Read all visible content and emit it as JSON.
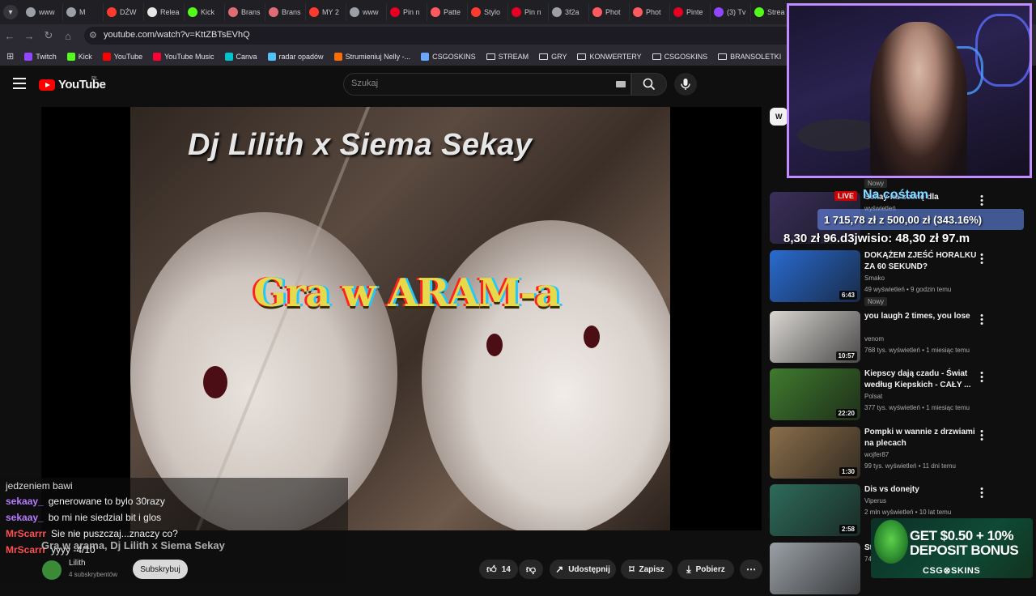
{
  "browser": {
    "tabs": [
      {
        "label": "www",
        "color": "#9aa0a6"
      },
      {
        "label": "M",
        "color": "#9aa0a6"
      },
      {
        "label": "DŹW",
        "color": "#ff3b30"
      },
      {
        "label": "Relea",
        "color": "#e6e6e6"
      },
      {
        "label": "Kick",
        "color": "#53fc18"
      },
      {
        "label": "Brans",
        "color": "#e06c75"
      },
      {
        "label": "Brans",
        "color": "#e06c75"
      },
      {
        "label": "MY 2",
        "color": "#ff3b30"
      },
      {
        "label": "www",
        "color": "#9aa0a6"
      },
      {
        "label": "Pin n",
        "color": "#e60023"
      },
      {
        "label": "Patte",
        "color": "#ff5a5f"
      },
      {
        "label": "Stylo",
        "color": "#ff3b30"
      },
      {
        "label": "Pin n",
        "color": "#e60023"
      },
      {
        "label": "3f2a",
        "color": "#9aa0a6"
      },
      {
        "label": "Phot",
        "color": "#ff5a5f"
      },
      {
        "label": "Phot",
        "color": "#ff5a5f"
      },
      {
        "label": "Pinte",
        "color": "#e60023"
      },
      {
        "label": "(3) Tv",
        "color": "#9146ff"
      },
      {
        "label": "Strea",
        "color": "#53fc18"
      }
    ],
    "url": "youtube.com/watch?v=KttZBTsEVhQ",
    "bookmarks": [
      {
        "label": "Twitch",
        "color": "#9146ff",
        "kind": "site"
      },
      {
        "label": "Kick",
        "color": "#53fc18",
        "kind": "site"
      },
      {
        "label": "YouTube",
        "color": "#ff0000",
        "kind": "site"
      },
      {
        "label": "YouTube Music",
        "color": "#ff0033",
        "kind": "site"
      },
      {
        "label": "Canva",
        "color": "#00c4cc",
        "kind": "site"
      },
      {
        "label": "radar opadów",
        "color": "#4fc3f7",
        "kind": "site"
      },
      {
        "label": "Strumieniuj Nelly -...",
        "color": "#ff6d00",
        "kind": "site"
      },
      {
        "label": "CSGOSKINS",
        "color": "#6aa8ff",
        "kind": "site"
      },
      {
        "label": "STREAM",
        "kind": "folder"
      },
      {
        "label": "GRY",
        "kind": "folder"
      },
      {
        "label": "KONWERTERY",
        "kind": "folder"
      },
      {
        "label": "CSGOSKINS",
        "kind": "folder"
      },
      {
        "label": "BRANSOLETKI",
        "kind": "folder"
      },
      {
        "label": "Ustawienia strumien...",
        "color": "#ff5722",
        "kind": "site"
      }
    ]
  },
  "youtube": {
    "wordmark": "YouTube",
    "country": "PL",
    "search_placeholder": "Szukaj",
    "icons": {
      "menu": "hamburger-icon",
      "search": "search-icon",
      "mic": "mic-icon",
      "keyboard": "keyboard-icon"
    }
  },
  "video": {
    "overlay_title": "Dj Lilith x Siema Sekay",
    "caption": "Gra w ARAM-a",
    "title": "Gra w arama, Dj Lilith x Siema Sekay",
    "channel": "Lilith",
    "subscribers": "4 subskrybentów",
    "subscribe_label": "Subskrybuj",
    "likes": "14",
    "share_label": "Udostępnij",
    "save_label": "Zapisz",
    "download_label": "Pobierz"
  },
  "chat": {
    "partial_line": "jedzeniem bawi",
    "messages": [
      {
        "user": "sekaay_",
        "color": "#b57cff",
        "text": "generowane to bylo 30razy"
      },
      {
        "user": "sekaay_",
        "color": "#b57cff",
        "text": "bo mi nie siedzial bit i glos"
      },
      {
        "user": "MrScarrr",
        "color": "#ff4f4f",
        "text": "Sie nie puszczaj...znaczy co?"
      },
      {
        "user": "MrScarrr",
        "color": "#ff4f4f",
        "text": "yyyy -4/10"
      }
    ],
    "overlay_user": "Lilith"
  },
  "sidebar": {
    "chip_label": "W",
    "items": [
      {
        "title": "Sekay na scenę dla",
        "channel": "",
        "meta": "wyświetleń",
        "badge": "Nowy",
        "duration": "",
        "thumb": "#3a2f5a"
      },
      {
        "title": "DOKĄŻEM ZJEŚĆ HORALKU ZA 60 SEKUND?",
        "channel": "Smako",
        "meta": "49 wyświetleń • 9 godzin temu",
        "badge": "Nowy",
        "duration": "6:43",
        "thumb": "#2a6bd1"
      },
      {
        "title": "you laugh 2 times, you lose",
        "channel": "venom",
        "meta": "768 tys. wyświetleń • 1 miesiąc temu",
        "badge": "",
        "duration": "10:57",
        "thumb": "#d9d6d2"
      },
      {
        "title": "Kiepscy dają czadu - Świat według Kiepskich - CAŁY ...",
        "channel": "Polsat",
        "meta": "377 tys. wyświetleń • 1 miesiąc temu",
        "badge": "",
        "duration": "22:20",
        "thumb": "#3f7a2e"
      },
      {
        "title": "Pompki w wannie z drzwiami na plecach",
        "channel": "wojfer87",
        "meta": "99 tys. wyświetleń • 11 dni temu",
        "badge": "",
        "duration": "1:30",
        "thumb": "#8a6e4a"
      },
      {
        "title": "Dis vs donejty",
        "channel": "Viperus",
        "meta": "2 mln wyświetleń • 10 lat temu",
        "badge": "",
        "duration": "2:58",
        "thumb": "#2e6b5a"
      },
      {
        "title": "St",
        "channel": "",
        "meta": "74 tys. wyświetleń • 3 dni temu",
        "badge": "",
        "duration": "",
        "thumb": "#9aa0a6"
      }
    ]
  },
  "stream_overlay": {
    "goal_header": "Na cośtam",
    "live_label": "LIVE",
    "goal_text": "1 715,78 zł z 500,00 zł (343.16%)",
    "ticker": "8,30 zł  96.d3jwisio: 48,30 zł  97.m",
    "ad_line1": "GET $0.50 + 10%",
    "ad_line2": "DEPOSIT BONUS",
    "ad_brand": "CSG⊗SKINS"
  }
}
